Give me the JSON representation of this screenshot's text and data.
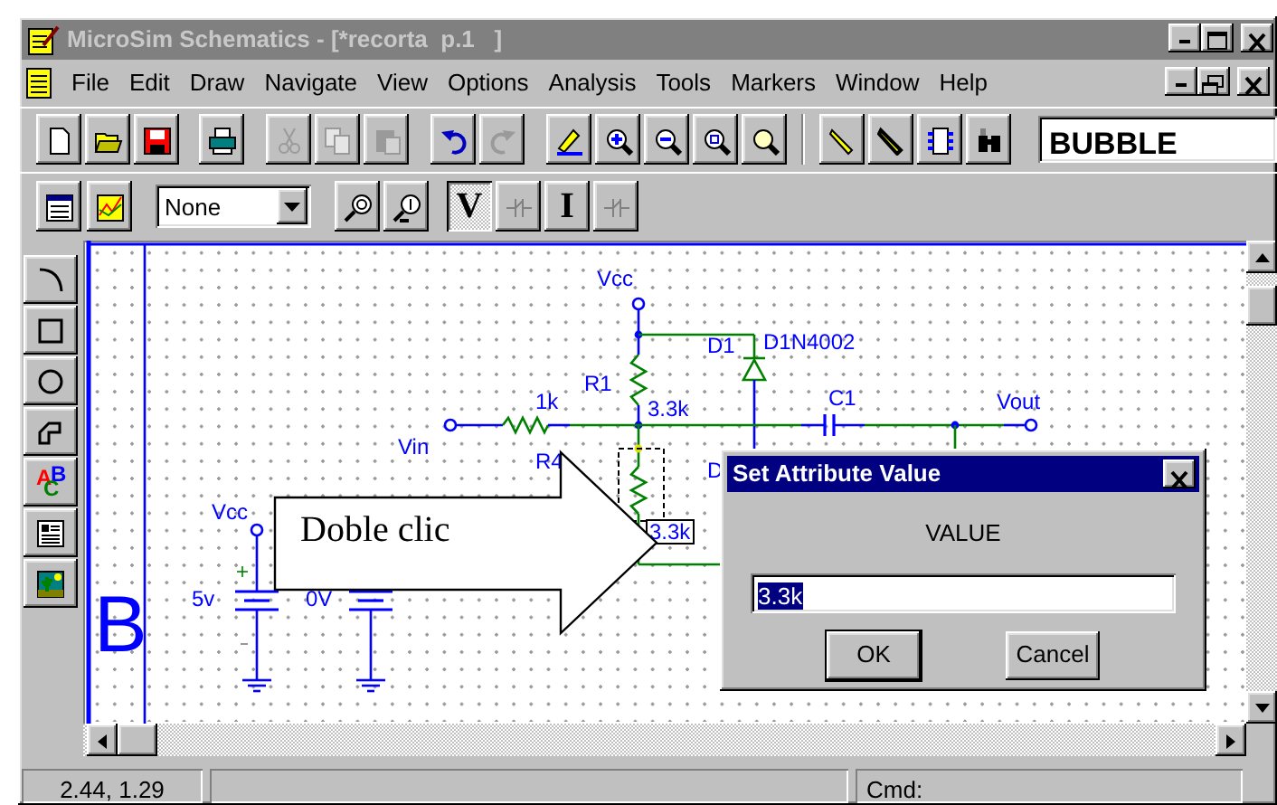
{
  "window": {
    "title": "MicroSim Schematics - [*recorta  p.1   ]",
    "active": false
  },
  "menu": [
    "File",
    "Edit",
    "Draw",
    "Navigate",
    "View",
    "Options",
    "Analysis",
    "Tools",
    "Markers",
    "Window",
    "Help"
  ],
  "toolbar": {
    "groups": [
      [
        {
          "disabled": false
        },
        {
          "disabled": false
        },
        {
          "disabled": false
        }
      ],
      [
        {
          "disabled": false
        }
      ],
      [
        {
          "disabled": true
        },
        {
          "disabled": true
        },
        {
          "disabled": true
        }
      ],
      [
        {
          "disabled": false
        },
        {
          "disabled": true
        }
      ],
      [
        {
          "disabled": false
        },
        {
          "disabled": false
        },
        {
          "disabled": false
        },
        {
          "disabled": false
        },
        {
          "disabled": false
        }
      ],
      [
        {
          "disabled": false
        },
        {
          "disabled": false
        },
        {
          "disabled": false
        },
        {
          "disabled": false
        }
      ]
    ],
    "part_field": "BUBBLE"
  },
  "probe_toolbar": {
    "marker_list": "None",
    "buttons": [
      {
        "text": "V",
        "pressed": true,
        "disabled": false
      },
      {
        "pressed": false,
        "disabled": true
      },
      {
        "text": "I",
        "pressed": false,
        "disabled": false
      },
      {
        "pressed": false,
        "disabled": true
      }
    ]
  },
  "palette": {
    "text_tool_letters": [
      "A",
      "B",
      "C"
    ]
  },
  "schematic": {
    "labels": [
      "Vcc",
      "D1",
      "D1N4002",
      "R1",
      "3.3k",
      "1k",
      "C1",
      "Vout",
      "Vin",
      "R4",
      "D",
      "Vcc",
      "5v",
      "0V"
    ],
    "selected_label": "3.3k",
    "margin_letter": "B",
    "callout": "Doble clic"
  },
  "dialog": {
    "title": "Set Attribute Value",
    "prompt": "VALUE",
    "value": "3.3k",
    "value_selected": true,
    "buttons": [
      {
        "label": "OK",
        "default": true
      },
      {
        "label": "Cancel",
        "default": false
      }
    ]
  },
  "status_bar": {
    "position": "2.44, 1.29",
    "command": "Cmd:"
  }
}
